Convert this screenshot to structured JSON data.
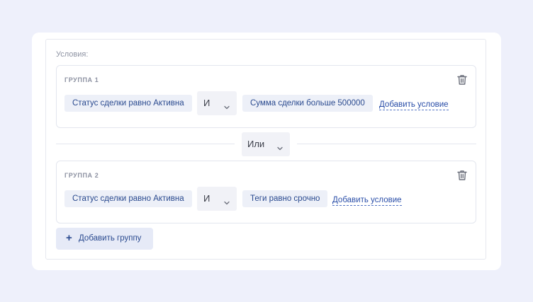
{
  "conditions_label": "Условия:",
  "groups": [
    {
      "title": "ГРУППА 1",
      "conditions": [
        "Статус сделки равно Активна",
        "Сумма сделки больше 500000"
      ],
      "operator": "И",
      "add_condition": "Добавить условие"
    },
    {
      "title": "ГРУППА 2",
      "conditions": [
        "Статус сделки равно Активна",
        "Теги равно срочно"
      ],
      "operator": "И",
      "add_condition": "Добавить условие"
    }
  ],
  "group_operator": "Или",
  "add_group": {
    "icon": "plus-icon",
    "label": "Добавить группу"
  },
  "icons": {
    "delete": "trash-icon",
    "dropdown": "chevron-down-icon"
  },
  "colors": {
    "accent": "#2a4ea8",
    "chip_bg": "#edf0f8",
    "page_bg": "#eef0fb"
  }
}
